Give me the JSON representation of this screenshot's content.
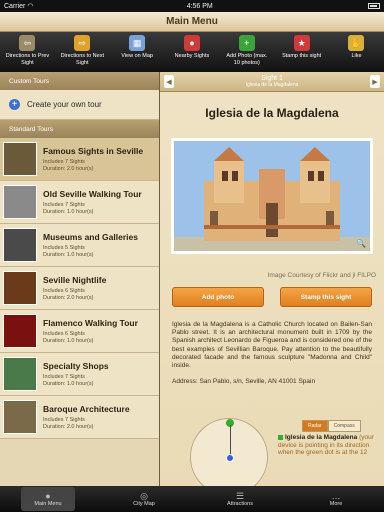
{
  "status": {
    "carrier": "Carrier",
    "wifi": "◠",
    "time": "4:56 PM"
  },
  "title": "Main Menu",
  "toolbar": [
    {
      "name": "prev-sight-button",
      "label": "Directions to Prev Sight",
      "icon": "⇦",
      "color": "#9a8a66"
    },
    {
      "name": "next-sight-button",
      "label": "Directions to Next Sight",
      "icon": "⇨",
      "color": "#e0a22a"
    },
    {
      "name": "view-on-map-button",
      "label": "View on Map",
      "icon": "▦",
      "color": "#7aa0d8"
    },
    {
      "name": "nearby-sights-button",
      "label": "Nearby Sights",
      "icon": "●",
      "color": "#d23a3a"
    },
    {
      "name": "add-photo-button",
      "label": "Add Photo (max. 10 photos)",
      "icon": "+",
      "color": "#3aa43a"
    },
    {
      "name": "stamp-sight-button",
      "label": "Stamp this sight",
      "icon": "★",
      "color": "#d23a3a"
    },
    {
      "name": "like-button",
      "label": "Like",
      "icon": "✋",
      "color": "#d8b03a"
    }
  ],
  "sidebar": {
    "custom_header": "Custom Tours",
    "create_label": "Create your own tour",
    "standard_header": "Standard Tours",
    "tours": [
      {
        "name": "Famous Sights in Seville",
        "sights": "Includes 7 Sights",
        "duration": "Duration: 2.0 hour(s)",
        "thumb": "#6a5a3a"
      },
      {
        "name": "Old Seville Walking Tour",
        "sights": "Includes 7 Sights",
        "duration": "Duration: 1.0 hour(s)",
        "thumb": "#8a8a8a"
      },
      {
        "name": "Museums and Galleries",
        "sights": "Includes 5 Sights",
        "duration": "Duration: 1.0 hour(s)",
        "thumb": "#4a4a4a"
      },
      {
        "name": "Seville Nightlife",
        "sights": "Includes 6 Sights",
        "duration": "Duration: 2.0 hour(s)",
        "thumb": "#6a3a1a"
      },
      {
        "name": "Flamenco Walking Tour",
        "sights": "Includes 6 Sights",
        "duration": "Duration: 1.0 hour(s)",
        "thumb": "#7a1010"
      },
      {
        "name": "Specialty Shops",
        "sights": "Includes 7 Sights",
        "duration": "Duration: 1.0 hour(s)",
        "thumb": "#4a7a4a"
      },
      {
        "name": "Baroque Architecture",
        "sights": "Includes 7 Sights",
        "duration": "Duration: 2.0 hour(s)",
        "thumb": "#7a6a4a"
      }
    ]
  },
  "detail": {
    "sight_label": "Sight 1",
    "sight_sub": "Iglesia de la Magdalena",
    "title": "Iglesia de la Magdalena",
    "courtesy": "Image Courtesy of Flickr and jl FILPO",
    "add_photo": "Add photo",
    "stamp": "Stamp this sight",
    "description": "Iglesia de la Magdalena is a Catholic Church located on Bailen-San Pablo street. It is an architectural monument built in 1709 by the Spanish architect Leonardo de Figueroa and is considered one of the best examples of Sevillian Baroque. Pay attention to the beautifully decorated facade and the famous sculpture \"Madonna and Child\" inside.",
    "address": "Address: San Pablo, s/n, Seville, AN 41001 Spain",
    "radar": {
      "tab_radar": "Radar",
      "tab_compass": "Compass",
      "name": "Iglesia de la Magdalena",
      "text": "(your device is pointing in its direction when the green dot is at the 12"
    }
  },
  "tabs": [
    {
      "name": "tab-main-menu",
      "label": "Main Menu",
      "icon": "●",
      "active": true
    },
    {
      "name": "tab-city-map",
      "label": "City Map",
      "icon": "◎",
      "active": false
    },
    {
      "name": "tab-attractions",
      "label": "Attractions",
      "icon": "☰",
      "active": false
    },
    {
      "name": "tab-more",
      "label": "More",
      "icon": "…",
      "active": false
    }
  ]
}
